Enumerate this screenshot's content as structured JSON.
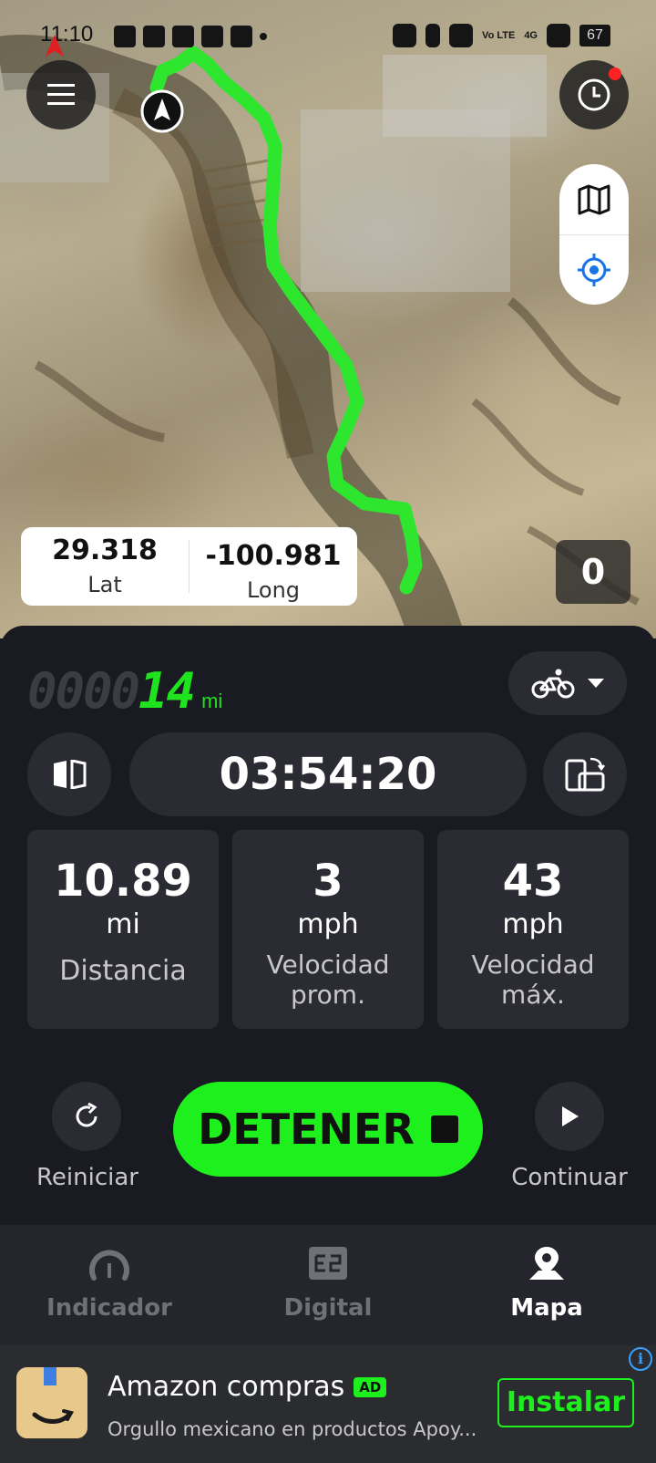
{
  "status_bar": {
    "time": "11:10",
    "network": "4G",
    "volte": "Vo LTE",
    "battery": "67"
  },
  "map": {
    "route_color": "#2ee62e",
    "coords": {
      "lat_value": "29.318",
      "lat_label": "Lat",
      "long_value": "-100.981",
      "long_label": "Long"
    },
    "speed": "0"
  },
  "panel": {
    "odometer": {
      "dim_digits": "0000",
      "lit_digits": "14",
      "unit": "mi"
    },
    "timer": "03:54:20",
    "stats": [
      {
        "value": "10.89",
        "unit": "mi",
        "label": "Distancia"
      },
      {
        "value": "3",
        "unit": "mph",
        "label": "Velocidad prom."
      },
      {
        "value": "43",
        "unit": "mph",
        "label": "Velocidad máx."
      }
    ],
    "controls": {
      "reset_label": "Reiniciar",
      "stop_label": "DETENER",
      "continue_label": "Continuar"
    }
  },
  "bottom_nav": [
    {
      "label": "Indicador",
      "icon": "gauge-icon",
      "active": false
    },
    {
      "label": "Digital",
      "icon": "digital-display-icon",
      "active": false
    },
    {
      "label": "Mapa",
      "icon": "map-pin-icon",
      "active": true
    }
  ],
  "ad": {
    "title": "Amazon compras",
    "badge": "AD",
    "subtitle": "Orgullo mexicano en productos Apoy...",
    "install_label": "Instalar",
    "accent": "#1ef01e"
  }
}
